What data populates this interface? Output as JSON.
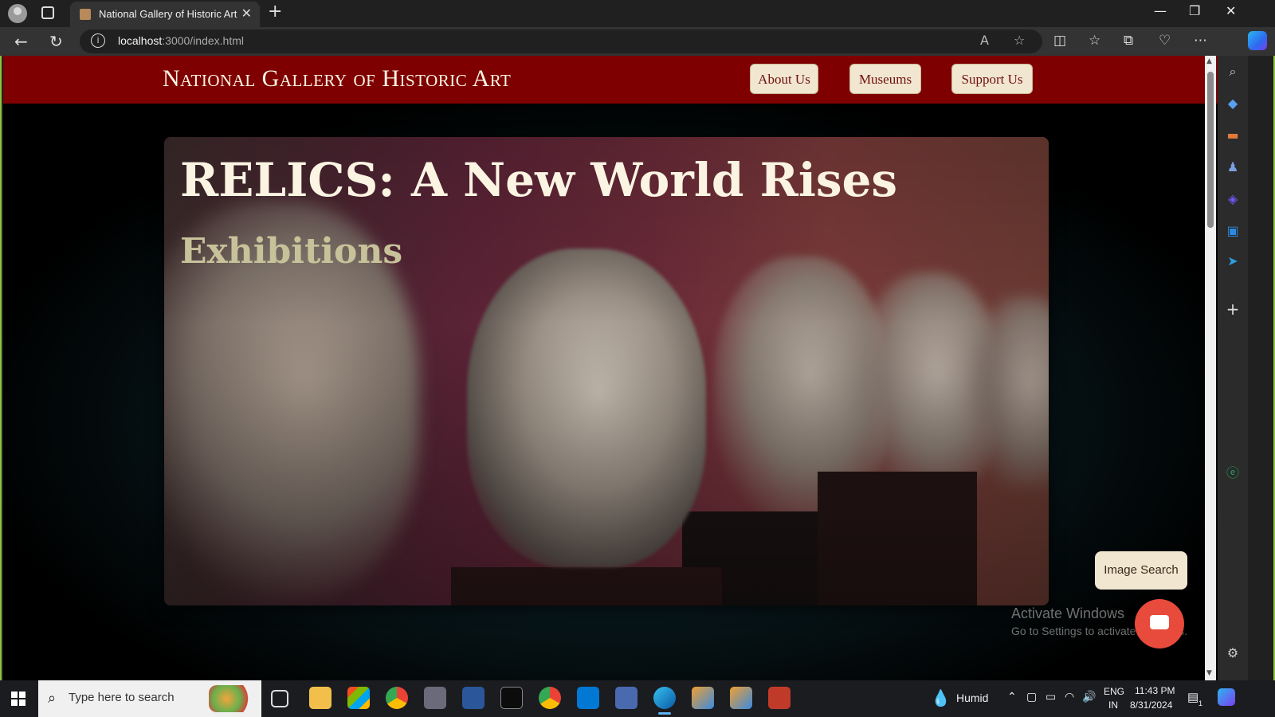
{
  "browser": {
    "tab_title": "National Gallery of Historic Art",
    "tab_close": "✕",
    "new_tab": "+",
    "url_host": "localhost",
    "url_path": ":3000/index.html",
    "window_controls": [
      "—",
      "❐",
      "✕"
    ]
  },
  "site": {
    "title": "National Gallery of Historic Art",
    "nav": [
      "About Us",
      "Museums",
      "Support Us"
    ],
    "hero_title": "RELICS: A New World Rises",
    "hero_subtitle": "Exhibitions",
    "image_search_label": "Image Search"
  },
  "watermark": {
    "line1": "Activate Windows",
    "line2": "Go to Settings to activate Windows."
  },
  "taskbar": {
    "search_placeholder": "Type here to search",
    "weather": "Humid",
    "lang_top": "ENG",
    "lang_bottom": "IN",
    "time": "11:43 PM",
    "date": "8/31/2024",
    "notification_count": "1"
  },
  "colors": {
    "header_red": "#7f0000",
    "nav_button_bg": "#f1e6cf",
    "chat_button": "#e84a3c",
    "frame_green": "#8dc63f"
  }
}
